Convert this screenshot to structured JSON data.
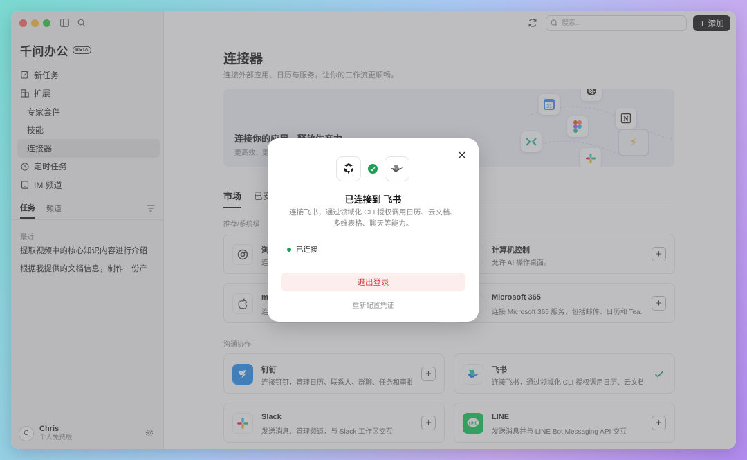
{
  "sidebar": {
    "brand": "千问办公",
    "beta": "BETA",
    "nav": [
      {
        "label": "新任务",
        "icon": "edit-icon"
      },
      {
        "label": "扩展",
        "icon": "extension-icon"
      },
      {
        "label": "专家套件"
      },
      {
        "label": "技能"
      },
      {
        "label": "连接器"
      },
      {
        "label": "定时任务",
        "icon": "clock-icon"
      },
      {
        "label": "IM 频道",
        "icon": "im-icon"
      }
    ],
    "task_tabs": [
      "任务",
      "频道"
    ],
    "recent_label": "最近",
    "recent_items": [
      "提取视频中的核心知识内容进行介绍",
      "根据我提供的文档信息，制作一份产"
    ],
    "user": {
      "initial": "C",
      "name": "Chris",
      "plan": "个人免费版"
    }
  },
  "header": {
    "search_placeholder": "搜索...",
    "add_label": "添加"
  },
  "main": {
    "title": "连接器",
    "subtitle": "连接外部应用、日历与服务，让你的工作流更顺畅。",
    "banner": {
      "title": "连接你的应用，释放生产力",
      "subtitle": "更高效、更"
    },
    "tabs": [
      "市场",
      "已安"
    ],
    "sections": [
      {
        "label": "推荐/系统级",
        "cards": [
          {
            "name": "浏览",
            "desc": "连接",
            "icon": "chrome-icon",
            "action": "add"
          },
          {
            "name": "计算机控制",
            "desc": "允许 AI 操作桌面。",
            "icon": "computer-icon",
            "action": "add"
          },
          {
            "name": "mac",
            "desc": "连接",
            "icon": "apple-icon",
            "action": "add"
          },
          {
            "name": "Microsoft 365",
            "desc": "连接 Microsoft 365 服务，包括邮件、日历和 Tea...",
            "icon": "microsoft-icon",
            "action": "add"
          }
        ]
      },
      {
        "label": "沟通协作",
        "cards": [
          {
            "name": "钉钉",
            "desc": "连接钉钉，管理日历、联系人、群聊、任务和审批...",
            "icon": "dingtalk-icon",
            "action": "add"
          },
          {
            "name": "飞书",
            "desc": "连接飞书，通过领域化 CLI 授权调用日历、云文档...",
            "icon": "feishu-icon",
            "action": "connected"
          },
          {
            "name": "Slack",
            "desc": "发送消息、管理频道，与 Slack 工作区交互",
            "icon": "slack-icon",
            "action": "add"
          },
          {
            "name": "LINE",
            "desc": "发送消息并与 LINE Bot Messaging API 交互",
            "icon": "line-icon",
            "action": "add"
          }
        ]
      }
    ]
  },
  "modal": {
    "title": "已连接到 飞书",
    "desc": "连接飞书，通过领域化 CLI 授权调用日历、云文档、多维表格、聊天等能力。",
    "status": "已连接",
    "logout_label": "退出登录",
    "reconfig_label": "重新配置凭证"
  },
  "colors": {
    "accent": "#111111",
    "success": "#1f9d55",
    "danger": "#d23a3a"
  }
}
